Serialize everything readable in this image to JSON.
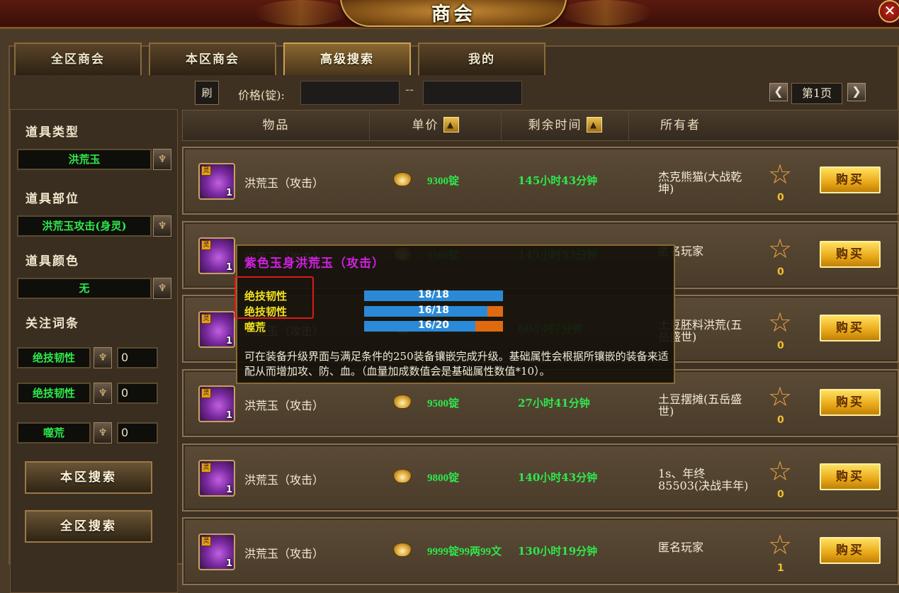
{
  "window": {
    "title": "商会",
    "close_glyph": "✕"
  },
  "tabs": [
    {
      "label": "全区商会",
      "active": false
    },
    {
      "label": "本区商会",
      "active": false
    },
    {
      "label": "高级搜索",
      "active": true
    },
    {
      "label": "我的",
      "active": false
    }
  ],
  "search": {
    "refresh_label": "刷",
    "price_label": "价格(锭):",
    "price_min": "",
    "price_max": "",
    "dash": "--",
    "page_label": "第1页",
    "prev_glyph": "❮",
    "next_glyph": "❯"
  },
  "filters": {
    "type_label": "道具类型",
    "type_value": "洪荒玉",
    "part_label": "道具部位",
    "part_value": "洪荒玉攻击(身灵)",
    "color_label": "道具颜色",
    "color_value": "无",
    "watch_label": "关注词条",
    "watch": [
      {
        "name": "绝技韧性",
        "value": "0"
      },
      {
        "name": "绝技韧性",
        "value": "0"
      },
      {
        "name": "噬荒",
        "value": "0"
      }
    ],
    "local_search": "本区搜索",
    "global_search": "全区搜索",
    "dropdown_glyph": "♆"
  },
  "table": {
    "headers": {
      "item": "物品",
      "price": "单价",
      "remain": "剩余时间",
      "owner": "所有者"
    },
    "sort_glyph": "▲",
    "badge_glyph": "灵",
    "star_glyph": "☆",
    "buy_label": "购买",
    "rows": [
      {
        "name": "洪荒玉（攻击）",
        "qty": "1",
        "price": "9300锭",
        "remain": "145小时43分钟",
        "owner": "杰克熊猫(大战乾坤)",
        "fav": "0"
      },
      {
        "name": "洪荒玉（攻击）",
        "qty": "1",
        "price": "9500锭",
        "remain": "145小时53分钟",
        "owner": "匿名玩家",
        "fav": "0"
      },
      {
        "name": "洪荒玉（攻击）",
        "qty": "1",
        "price": "",
        "remain": "60小时7分钟",
        "owner": "土豆胚料洪荒(五岳盛世)",
        "fav": "0"
      },
      {
        "name": "洪荒玉（攻击）",
        "qty": "1",
        "price": "9500锭",
        "remain": "27小时41分钟",
        "owner": "土豆摆摊(五岳盛世)",
        "fav": "0"
      },
      {
        "name": "洪荒玉（攻击）",
        "qty": "1",
        "price": "9800锭",
        "remain": "140小时43分钟",
        "owner": "1s、年终85503(决战丰年)",
        "fav": "0"
      },
      {
        "name": "洪荒玉（攻击）",
        "qty": "1",
        "price": "9999锭99两99文",
        "remain": "130小时19分钟",
        "owner": "匿名玩家",
        "fav": "1"
      }
    ]
  },
  "tooltip": {
    "title": "紫色玉身洪荒玉（攻击）",
    "attrs": [
      {
        "name": "绝技韧性",
        "current": 18,
        "max": 18,
        "text": "18/18"
      },
      {
        "name": "绝技韧性",
        "current": 16,
        "max": 18,
        "text": "16/18"
      },
      {
        "name": "噬荒",
        "current": 16,
        "max": 20,
        "text": "16/20"
      }
    ],
    "description": "可在装备升级界面与满足条件的250装备镶嵌完成升级。基础属性会根据所镶嵌的装备来适配从而增加攻、防、血。（血量加成数值会是基础属性数值*10）。"
  },
  "colors": {
    "green_text": "#2ee84c",
    "tooltip_title": "#d020e0",
    "attr_yellow": "#f0e020",
    "bar_blue": "#2a8ad8",
    "bar_orange": "#e06a10",
    "buy_gold": "#e8a818",
    "highlight_red": "#e01818"
  }
}
